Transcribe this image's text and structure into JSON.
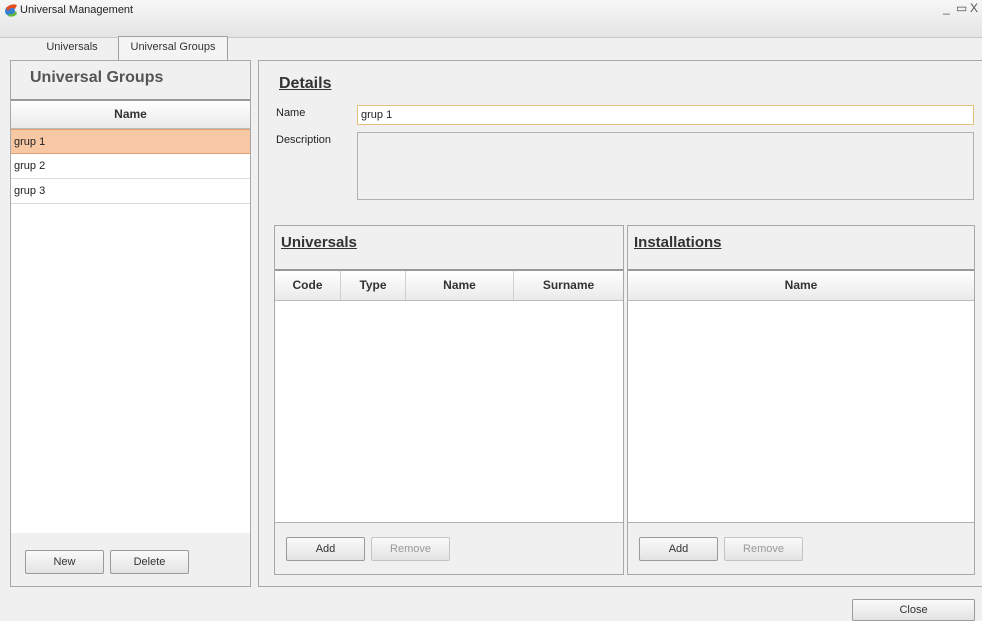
{
  "window": {
    "title": "Universal Management",
    "controls": [
      "_",
      "▭",
      "X"
    ]
  },
  "tabs": [
    {
      "label": "Universals"
    },
    {
      "label": "Universal Groups",
      "active": true
    }
  ],
  "left": {
    "title": "Universal Groups",
    "column": "Name",
    "rows": [
      "grup 1",
      "grup 2",
      "grup 3"
    ],
    "selected_index": 0,
    "new_label": "New",
    "delete_label": "Delete"
  },
  "details": {
    "title": "Details",
    "name_label": "Name",
    "name_value": "grup 1",
    "description_label": "Description",
    "description_value": ""
  },
  "universals": {
    "title": "Universals",
    "columns": [
      "Code",
      "Type",
      "Name",
      "Surname"
    ],
    "add_label": "Add",
    "remove_label": "Remove"
  },
  "installations": {
    "title": "Installations",
    "columns": [
      "Name"
    ],
    "add_label": "Add",
    "remove_label": "Remove"
  },
  "close_label": "Close",
  "colors": {
    "selected_row": "#f8c8a4",
    "input_border": "#e2c27a"
  },
  "icons": {
    "app": "app-logo-icon"
  }
}
